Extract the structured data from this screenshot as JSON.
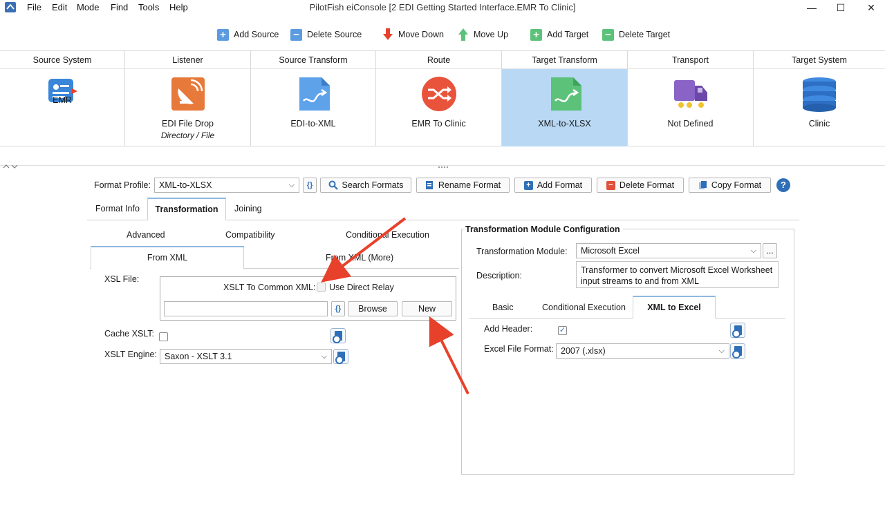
{
  "window": {
    "title": "PilotFish eiConsole [2 EDI Getting Started Interface.EMR To Clinic]",
    "menu": [
      "File",
      "Edit",
      "Mode",
      "Find",
      "Tools",
      "Help"
    ],
    "controls": {
      "minimize": "—",
      "maximize": "☐",
      "close": "✕"
    }
  },
  "toolbar": {
    "add_source": "Add Source",
    "delete_source": "Delete Source",
    "move_down": "Move Down",
    "move_up": "Move Up",
    "add_target": "Add Target",
    "delete_target": "Delete Target"
  },
  "pipeline": {
    "stages": [
      {
        "header": "Source System",
        "label": "EMR",
        "sub": "",
        "icon": "emr-icon"
      },
      {
        "header": "Listener",
        "label": "EDI File Drop",
        "sub": "Directory / File",
        "icon": "satellite-dish-icon"
      },
      {
        "header": "Source Transform",
        "label": "EDI-to-XML",
        "sub": "",
        "icon": "transform-document-icon"
      },
      {
        "header": "Route",
        "label": "EMR To Clinic",
        "sub": "",
        "icon": "route-shuffle-icon"
      },
      {
        "header": "Target Transform",
        "label": "XML-to-XLSX",
        "sub": "",
        "icon": "transform-document-icon",
        "selected": true
      },
      {
        "header": "Transport",
        "label": "Not Defined",
        "sub": "",
        "icon": "truck-icon"
      },
      {
        "header": "Target System",
        "label": "Clinic",
        "sub": "",
        "icon": "database-icon"
      }
    ]
  },
  "format": {
    "profile_label": "Format Profile:",
    "profile_value": "XML-to-XLSX",
    "search": "Search Formats",
    "rename": "Rename Format",
    "add": "Add Format",
    "delete": "Delete Format",
    "copy": "Copy Format",
    "help": "?"
  },
  "tabs": [
    "Format Info",
    "Transformation",
    "Joining"
  ],
  "subtabs_row1": [
    "Advanced",
    "Compatibility",
    "Conditional Execution"
  ],
  "subtabs_row2": [
    "From XML",
    "From XML (More)"
  ],
  "left": {
    "xsl_file_label": "XSL File:",
    "xslt_common_label": "XSLT To Common XML:",
    "direct_relay": "Use Direct Relay",
    "xsl_path": "",
    "browse": "Browse",
    "new": "New",
    "cache_label": "Cache XSLT:",
    "engine_label": "XSLT Engine:",
    "engine_value": "Saxon - XSLT 3.1"
  },
  "right": {
    "title": "Transformation Module Configuration",
    "module_label": "Transformation Module:",
    "module_value": "Microsoft Excel",
    "ellipsis": "...",
    "desc_label": "Description:",
    "desc_value": "Transformer to convert Microsoft Excel Worksheet input streams to and from XML",
    "tabs": [
      "Basic",
      "Conditional Execution",
      "XML to Excel"
    ],
    "add_header_label": "Add Header:",
    "add_header_checked": "✓",
    "file_format_label": "Excel File Format:",
    "file_format_value": "2007 (.xlsx)"
  },
  "colors": {
    "selected_stage": "#b8d8f4",
    "arrow": "#e8412b",
    "accent": "#2f6fb8"
  }
}
